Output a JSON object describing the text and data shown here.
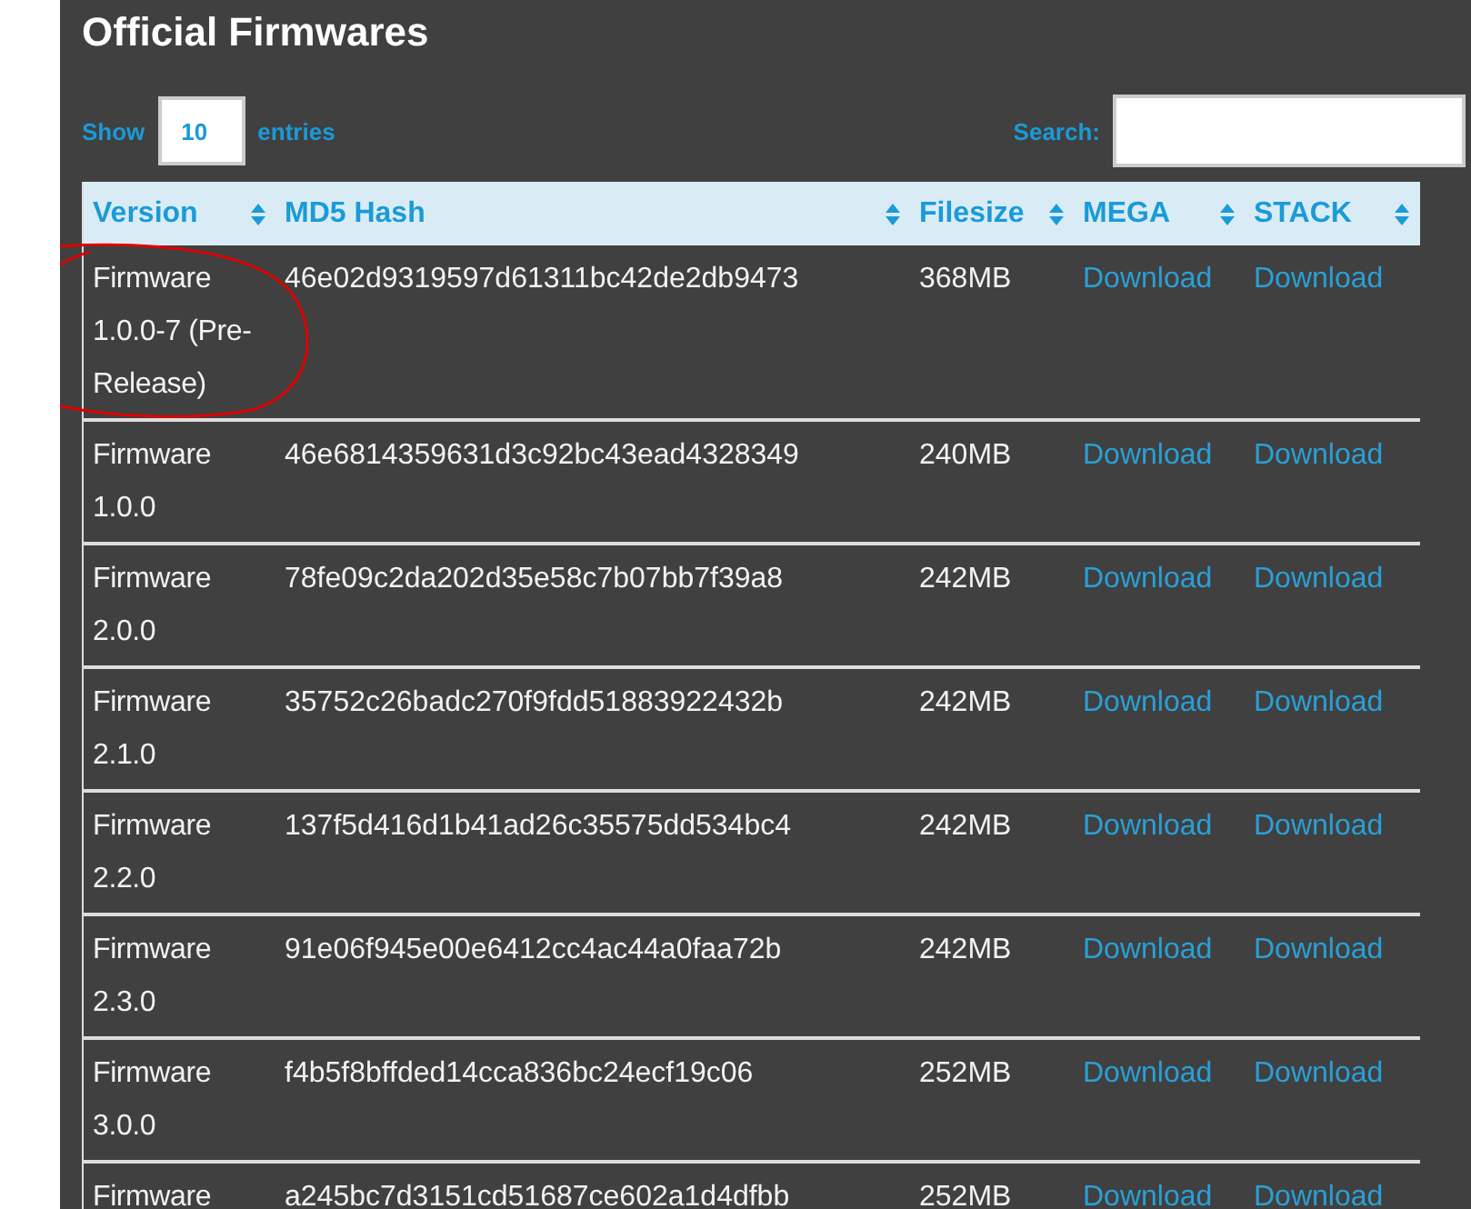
{
  "title": "Official Firmwares",
  "length_control": {
    "before": "Show",
    "value": "10",
    "after": "entries"
  },
  "search": {
    "label": "Search:"
  },
  "table": {
    "columns": [
      "Version",
      "MD5 Hash",
      "Filesize",
      "MEGA",
      "STACK"
    ],
    "rows": [
      {
        "version": "Firmware 1.0.0-7 (Pre-Release)",
        "md5": "46e02d9319597d61311bc42de2db9473",
        "filesize": "368MB",
        "mega": "Download",
        "stack": "Download",
        "annotated": true
      },
      {
        "version": "Firmware 1.0.0",
        "md5": "46e6814359631d3c92bc43ead4328349",
        "filesize": "240MB",
        "mega": "Download",
        "stack": "Download",
        "annotated": false
      },
      {
        "version": "Firmware 2.0.0",
        "md5": "78fe09c2da202d35e58c7b07bb7f39a8",
        "filesize": "242MB",
        "mega": "Download",
        "stack": "Download",
        "annotated": false
      },
      {
        "version": "Firmware 2.1.0",
        "md5": "35752c26badc270f9fdd51883922432b",
        "filesize": "242MB",
        "mega": "Download",
        "stack": "Download",
        "annotated": false
      },
      {
        "version": "Firmware 2.2.0",
        "md5": "137f5d416d1b41ad26c35575dd534bc4",
        "filesize": "242MB",
        "mega": "Download",
        "stack": "Download",
        "annotated": false
      },
      {
        "version": "Firmware 2.3.0",
        "md5": "91e06f945e00e6412cc4ac44a0faa72b",
        "filesize": "242MB",
        "mega": "Download",
        "stack": "Download",
        "annotated": false
      },
      {
        "version": "Firmware 3.0.0",
        "md5": "f4b5f8bffded14cca836bc24ecf19c06",
        "filesize": "252MB",
        "mega": "Download",
        "stack": "Download",
        "annotated": false
      },
      {
        "version": "Firmware",
        "md5": "a245bc7d3151cd51687ce602a1d4dfbb",
        "filesize": "252MB",
        "mega": "Download",
        "stack": "Download",
        "annotated": false
      }
    ]
  }
}
